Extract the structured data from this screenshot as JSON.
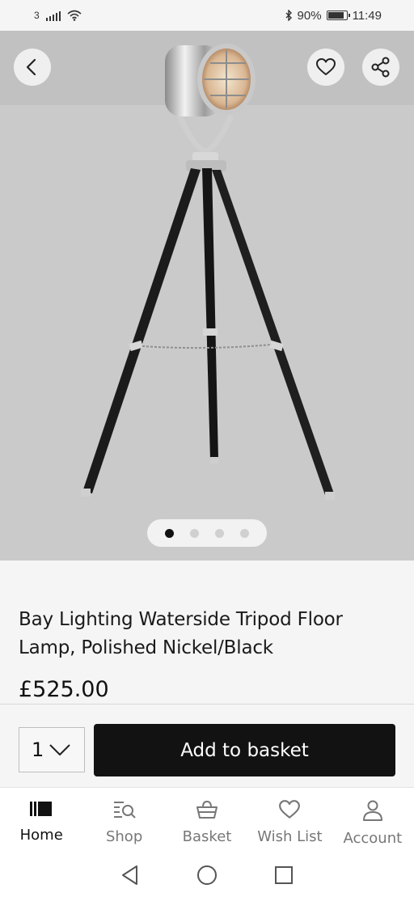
{
  "status_bar": {
    "carrier": "3",
    "battery": "90%",
    "battery_level": 0.9,
    "time": "11:49",
    "icons": [
      "signal-icon",
      "wifi-icon",
      "bluetooth-icon",
      "battery-icon"
    ]
  },
  "hero": {
    "image": "tripod-floor-lamp",
    "carousel": {
      "count": 4,
      "active_index": 0
    },
    "buttons": [
      "back-icon",
      "heart-icon",
      "share-icon"
    ]
  },
  "product": {
    "title": "Bay Lighting Waterside Tripod Floor Lamp, Polished Nickel/Black",
    "price": "£525.00"
  },
  "purchase": {
    "quantity": "1",
    "add_label": "Add to basket"
  },
  "nav": {
    "items": [
      {
        "label": "Home",
        "icon": "home-icon",
        "active": true
      },
      {
        "label": "Shop",
        "icon": "shop-search-icon",
        "active": false
      },
      {
        "label": "Basket",
        "icon": "basket-icon",
        "active": false
      },
      {
        "label": "Wish List",
        "icon": "heart-icon",
        "active": false
      },
      {
        "label": "Account",
        "icon": "person-icon",
        "active": false
      }
    ]
  },
  "system_nav": [
    "back-triangle-icon",
    "home-circle-icon",
    "recents-square-icon"
  ],
  "colors": {
    "accent": "#121212",
    "hero_background": "#cacaca",
    "page_background": "#f5f5f5"
  }
}
